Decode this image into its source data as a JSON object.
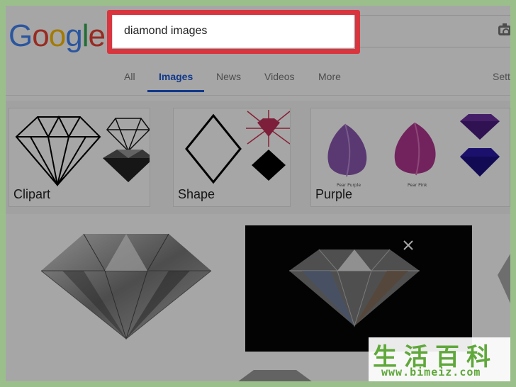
{
  "logo": {
    "letters": [
      "G",
      "o",
      "o",
      "g",
      "l",
      "e"
    ],
    "colors": [
      "#4285f4",
      "#ea4335",
      "#fbbc05",
      "#4285f4",
      "#34a853",
      "#ea4335"
    ]
  },
  "search": {
    "query": "diamond images"
  },
  "tabs": [
    {
      "label": "All"
    },
    {
      "label": "Images",
      "active": true
    },
    {
      "label": "News"
    },
    {
      "label": "Videos"
    },
    {
      "label": "More"
    },
    {
      "label": "Sett"
    }
  ],
  "categories": [
    {
      "label": "Clipart"
    },
    {
      "label": "Shape"
    },
    {
      "label": "Purple"
    }
  ],
  "watermark": {
    "chars": "生活百科",
    "url": "www.bimeiz.com"
  },
  "colors": {
    "highlight": "#d9353f",
    "active_tab": "#1a57d6",
    "watermark": "#5fa83a"
  }
}
